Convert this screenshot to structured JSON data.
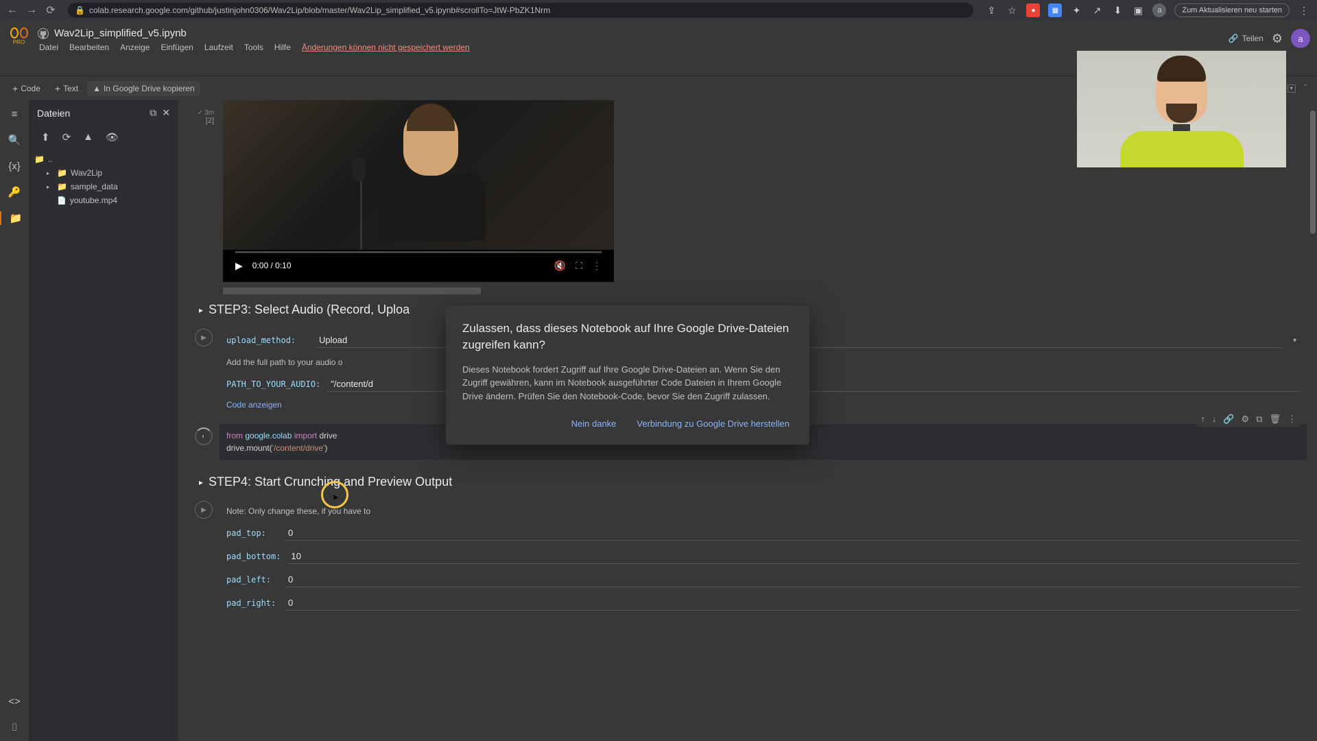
{
  "browser": {
    "url": "colab.research.google.com/github/justinjohn0306/Wav2Lip/blob/master/Wav2Lip_simplified_v5.ipynb#scrollTo=JtW-PbZK1Nrm",
    "update_button": "Zum Aktualisieren neu starten",
    "avatar": "a"
  },
  "colab": {
    "logo_text": "PRO",
    "title": "Wav2Lip_simplified_v5.ipynb",
    "menu": {
      "file": "Datei",
      "edit": "Bearbeiten",
      "view": "Anzeige",
      "insert": "Einfügen",
      "runtime": "Laufzeit",
      "tools": "Tools",
      "help": "Hilfe"
    },
    "save_warning": "Änderungen können nicht gespeichert werden",
    "share": "Teilen",
    "avatar": "a"
  },
  "toolbar": {
    "code": "Code",
    "text": "Text",
    "copy_drive": "In Google Drive kopieren"
  },
  "files_panel": {
    "title": "Dateien",
    "tree": {
      "root": "..",
      "folder1": "Wav2Lip",
      "folder2": "sample_data",
      "file1": "youtube.mp4"
    }
  },
  "video": {
    "time": "0:00 / 0:10"
  },
  "cell_ref": "[2]",
  "cell_time": "3m",
  "step3": {
    "title": "STEP3: Select Audio (Record, Uploa",
    "upload_label": "upload_method:",
    "upload_val": "Upload",
    "path_hint": "Add the full path to your audio o",
    "path_label": "PATH_TO_YOUR_AUDIO:",
    "path_val": "\"/content/d",
    "code_link": "Code anzeigen"
  },
  "code": {
    "line1_kw1": "from",
    "line1_mod": "google.colab",
    "line1_kw2": "import",
    "line1_name": "drive",
    "line2_pre": "drive.mount(",
    "line2_str": "'/content/drive'",
    "line2_post": ")"
  },
  "step4": {
    "title": "STEP4: Start Crunching and Preview Output",
    "note": "Note: Only change these, if you have to",
    "pad_top_label": "pad_top:",
    "pad_top_val": "0",
    "pad_bottom_label": "pad_bottom:",
    "pad_bottom_val": "10",
    "pad_left_label": "pad_left:",
    "pad_left_val": "0",
    "pad_right_label": "pad_right:",
    "pad_right_val": "0"
  },
  "modal": {
    "title": "Zulassen, dass dieses Notebook auf Ihre Google Drive-Dateien zugreifen kann?",
    "body": "Dieses Notebook fordert Zugriff auf Ihre Google Drive-Dateien an. Wenn Sie den Zugriff gewähren, kann im Notebook ausgeführter Code Dateien in Ihrem Google Drive ändern. Prüfen Sie den Notebook-Code, bevor Sie den Zugriff zulassen.",
    "no": "Nein danke",
    "yes": "Verbindung zu Google Drive herstellen"
  }
}
